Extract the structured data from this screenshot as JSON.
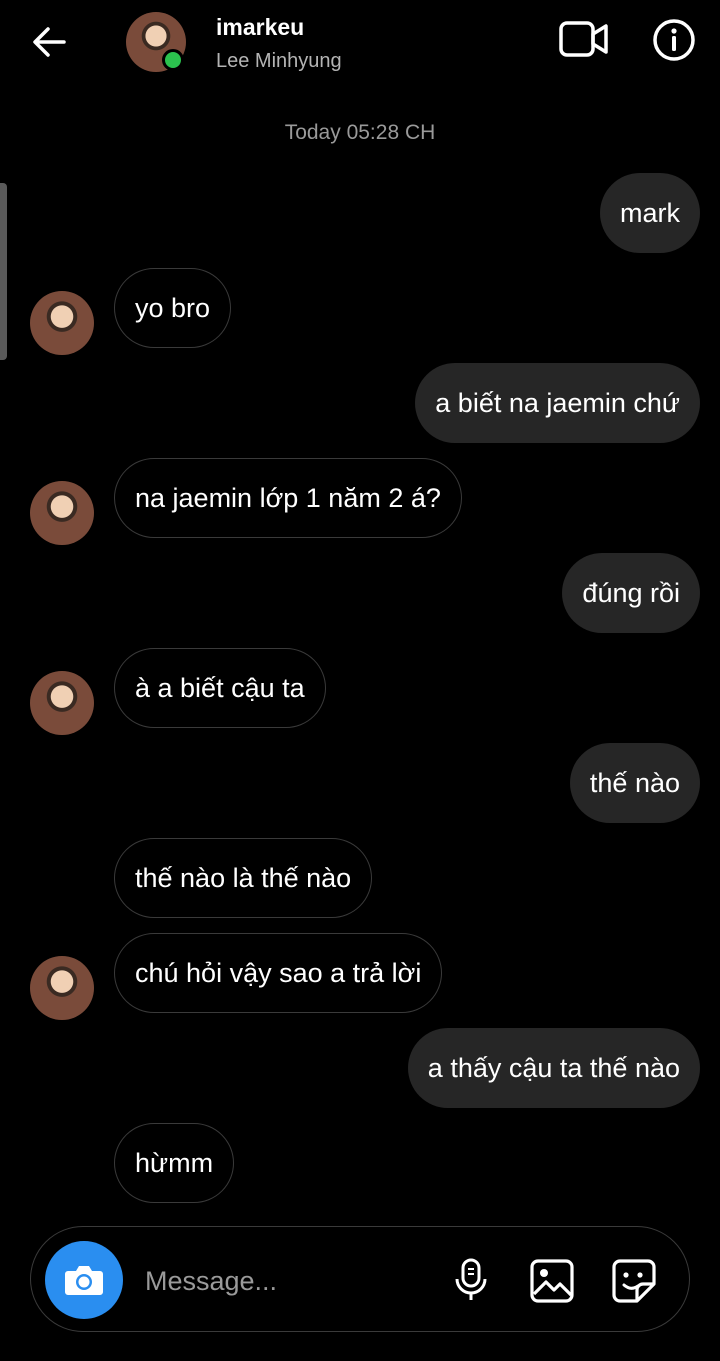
{
  "header": {
    "username": "imarkeu",
    "fullname": "Lee Minhyung",
    "online": true
  },
  "conversation": {
    "timestamp": "Today 05:28 CH",
    "messages": [
      {
        "side": "sent",
        "text": "mark"
      },
      {
        "side": "recv",
        "text": "yo bro",
        "avatar": true
      },
      {
        "side": "sent",
        "text": "a biết na jaemin chứ"
      },
      {
        "side": "recv",
        "text": "na jaemin lớp 1 năm 2 á?",
        "avatar": true
      },
      {
        "side": "sent",
        "text": "đúng rồi"
      },
      {
        "side": "recv",
        "text": "à a biết cậu ta",
        "avatar": true
      },
      {
        "side": "sent",
        "text": "thế nào"
      },
      {
        "side": "recv",
        "text": "thế nào là thế nào",
        "avatar": false
      },
      {
        "side": "recv",
        "text": "chú hỏi vậy sao a trả lời",
        "avatar": true
      },
      {
        "side": "sent",
        "text": "a thấy cậu ta thế nào"
      },
      {
        "side": "recv",
        "text": "hừmm",
        "avatar": false
      }
    ]
  },
  "composer": {
    "placeholder": "Message..."
  },
  "colors": {
    "background": "#000000",
    "sent_bubble": "#262626",
    "recv_border": "#3a3a3a",
    "camera_button": "#2a8ef0",
    "online_dot": "#2bc24e"
  },
  "icons": [
    "back-arrow-icon",
    "video-call-icon",
    "info-icon",
    "camera-icon",
    "microphone-icon",
    "gallery-icon",
    "sticker-icon"
  ]
}
